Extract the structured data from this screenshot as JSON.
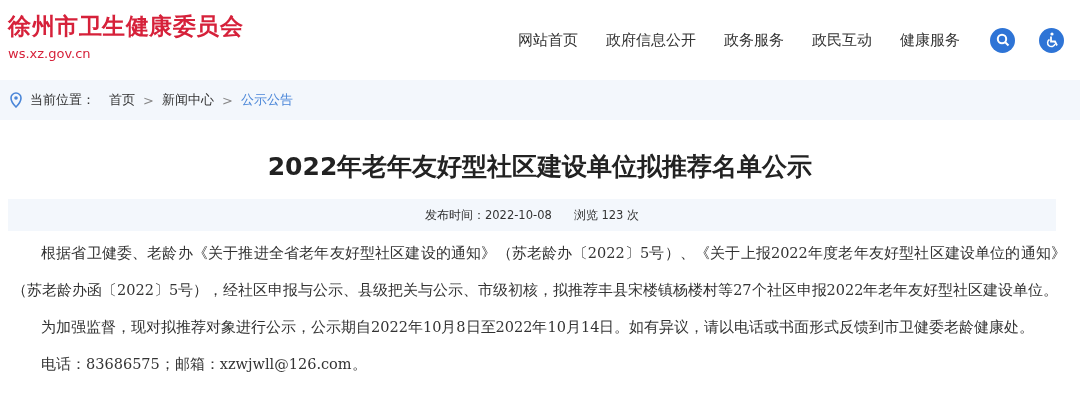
{
  "site": {
    "name": "徐州市卫生健康委员会",
    "domain": "ws.xz.gov.cn"
  },
  "nav": [
    {
      "label": "网站首页"
    },
    {
      "label": "政府信息公开"
    },
    {
      "label": "政务服务"
    },
    {
      "label": "政民互动"
    },
    {
      "label": "健康服务"
    }
  ],
  "breadcrumb": {
    "label": "当前位置：",
    "separator": ">",
    "items": [
      {
        "label": "首页",
        "current": false
      },
      {
        "label": "新闻中心",
        "current": false
      },
      {
        "label": "公示公告",
        "current": true
      }
    ]
  },
  "article": {
    "title": "2022年老年友好型社区建设单位拟推荐名单公示",
    "published": "发布时间：2022-10-08",
    "views": "浏览 123 次",
    "paragraphs": [
      "根据省卫健委、老龄办《关于推进全省老年友好型社区建设的通知》（苏老龄办〔2022〕5号）、《关于上报2022年度老年友好型社区建设单位的通知》（苏老龄办函〔2022〕5号），经社区申报与公示、县级把关与公示、市级初核，拟推荐丰县宋楼镇杨楼村等27个社区申报2022年老年友好型社区建设单位。",
      "为加强监督，现对拟推荐对象进行公示，公示期自2022年10月8日至2022年10月14日。如有异议，请以电话或书面形式反馈到市卫健委老龄健康处。",
      "电话：83686575；邮箱：xzwjwll@126.com。"
    ]
  }
}
